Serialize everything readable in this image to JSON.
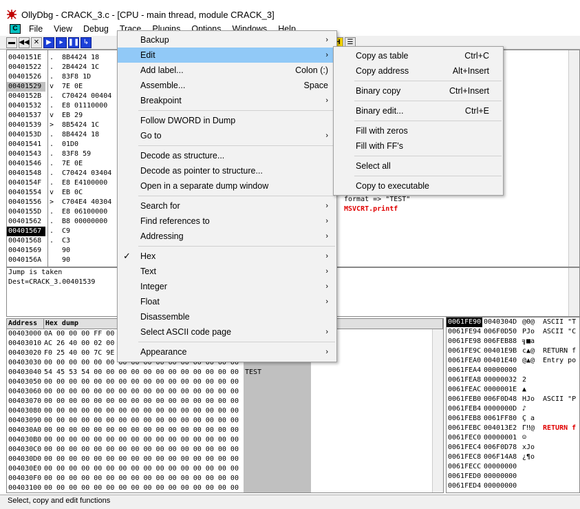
{
  "window": {
    "title": "OllyDbg - CRACK_3.c - [CPU - main thread, module CRACK_3]"
  },
  "menubar": {
    "items": [
      "File",
      "View",
      "Debug",
      "Trace",
      "Plugins",
      "Options",
      "Windows",
      "Help"
    ]
  },
  "toolbar": {
    "buttons": [
      "open",
      "restart",
      "close",
      "run",
      "step-into",
      "pause",
      "step-over",
      "M",
      "H",
      "list"
    ]
  },
  "cpu": {
    "addresses": [
      "0040151E",
      "00401522",
      "00401526",
      "00401529",
      "0040152B",
      "00401532",
      "00401537",
      "00401539",
      "0040153D",
      "00401541",
      "00401543",
      "00401546",
      "00401548",
      "0040154F",
      "00401554",
      "00401556",
      "0040155D",
      "00401562",
      "00401567",
      "00401568",
      "00401569",
      "0040156A"
    ],
    "marks": [
      ".",
      ".",
      ".",
      "v",
      ".",
      ".",
      "v",
      ">",
      ".",
      ".",
      ".",
      ".",
      ".",
      ".",
      "v",
      ">",
      ".",
      ".",
      ".",
      ".",
      "",
      ""
    ],
    "hex": [
      "8B4424 18",
      "2B4424 1C",
      "83F8 1D",
      "7E 0E",
      "C70424 00404",
      "E8 01110000",
      "EB 29",
      "8B5424 1C",
      "8B4424 18",
      "01D0",
      "83F8 59",
      "7E 0E",
      "C70424 03404",
      "E8 E4100000",
      "EB 0C",
      "C704E4 40304",
      "E8 06100000",
      "B8 00000000",
      "C9",
      "C3",
      "90",
      "90"
    ],
    "selected_address": "00401529",
    "eip_address": "00401567",
    "comments": [
      {
        "text": "format => \"TEST\"",
        "red": false
      },
      {
        "text": "MSVCRT.printf",
        "red": true
      }
    ]
  },
  "info": {
    "lines": [
      "Jump is taken",
      "Dest=CRACK_3.00401539"
    ]
  },
  "dump": {
    "headers": [
      "Address",
      "Hex dump"
    ],
    "rows": [
      {
        "addr": "00403000",
        "hex": "0A 00 00 00 FF 00",
        "ascii": ""
      },
      {
        "addr": "00403010",
        "hex": "AC 26 40 00 02 00",
        "ascii": ""
      },
      {
        "addr": "00403020",
        "hex": "F0 25 40 00 7C 9E",
        "ascii": ""
      },
      {
        "addr": "00403030",
        "hex": "00 00 00 00 00 00 00 00 00 00 00 00 00 00 00 00",
        "ascii": ""
      },
      {
        "addr": "00403040",
        "hex": "54 45 53 54 00 00 00 00 00 00 00 00 00 00 00 00",
        "ascii": "TEST"
      },
      {
        "addr": "00403050",
        "hex": "00 00 00 00 00 00 00 00 00 00 00 00 00 00 00 00",
        "ascii": ""
      },
      {
        "addr": "00403060",
        "hex": "00 00 00 00 00 00 00 00 00 00 00 00 00 00 00 00",
        "ascii": ""
      },
      {
        "addr": "00403070",
        "hex": "00 00 00 00 00 00 00 00 00 00 00 00 00 00 00 00",
        "ascii": ""
      },
      {
        "addr": "00403080",
        "hex": "00 00 00 00 00 00 00 00 00 00 00 00 00 00 00 00",
        "ascii": ""
      },
      {
        "addr": "00403090",
        "hex": "00 00 00 00 00 00 00 00 00 00 00 00 00 00 00 00",
        "ascii": ""
      },
      {
        "addr": "004030A0",
        "hex": "00 00 00 00 00 00 00 00 00 00 00 00 00 00 00 00",
        "ascii": ""
      },
      {
        "addr": "004030B0",
        "hex": "00 00 00 00 00 00 00 00 00 00 00 00 00 00 00 00",
        "ascii": ""
      },
      {
        "addr": "004030C0",
        "hex": "00 00 00 00 00 00 00 00 00 00 00 00 00 00 00 00",
        "ascii": ""
      },
      {
        "addr": "004030D0",
        "hex": "00 00 00 00 00 00 00 00 00 00 00 00 00 00 00 00",
        "ascii": ""
      },
      {
        "addr": "004030E0",
        "hex": "00 00 00 00 00 00 00 00 00 00 00 00 00 00 00 00",
        "ascii": ""
      },
      {
        "addr": "004030F0",
        "hex": "00 00 00 00 00 00 00 00 00 00 00 00 00 00 00 00",
        "ascii": ""
      },
      {
        "addr": "00403100",
        "hex": "00 00 00 00 00 00 00 00 00 00 00 00 00 00 00 00",
        "ascii": ""
      }
    ]
  },
  "stack": {
    "rows": [
      {
        "addr": "0061FE90",
        "val": "0040304D",
        "txt": "@0@",
        "cmt": "ASCII \"T",
        "red": false
      },
      {
        "addr": "0061FE94",
        "val": "006F0D50",
        "txt": "PJo",
        "cmt": "ASCII \"C",
        "red": false
      },
      {
        "addr": "0061FE98",
        "val": "006FEB88",
        "txt": "╗■a",
        "cmt": "",
        "red": false
      },
      {
        "addr": "0061FE9C",
        "val": "00401E9B",
        "txt": "c▲@",
        "cmt": "RETURN f",
        "red": false
      },
      {
        "addr": "0061FEA0",
        "val": "00401E40",
        "txt": "@▲@",
        "cmt": "Entry po",
        "red": false
      },
      {
        "addr": "0061FEA4",
        "val": "00000000",
        "txt": "",
        "cmt": "",
        "red": false
      },
      {
        "addr": "0061FEA8",
        "val": "00000032",
        "txt": "2",
        "cmt": "",
        "red": false
      },
      {
        "addr": "0061FEAC",
        "val": "0000001E",
        "txt": "▲",
        "cmt": "",
        "red": false
      },
      {
        "addr": "0061FEB0",
        "val": "006F0D48",
        "txt": "HJo",
        "cmt": "ASCII \"P",
        "red": false
      },
      {
        "addr": "0061FEB4",
        "val": "0000000D",
        "txt": "♪",
        "cmt": "",
        "red": false
      },
      {
        "addr": "0061FEB8",
        "val": "0061FF80",
        "txt": "Ç a",
        "cmt": "",
        "red": false
      },
      {
        "addr": "0061FEBC",
        "val": "004013E2",
        "txt": "Γ‼@",
        "cmt": "RETURN f",
        "red": true
      },
      {
        "addr": "0061FEC0",
        "val": "00000001",
        "txt": "☺",
        "cmt": "",
        "red": false
      },
      {
        "addr": "0061FEC4",
        "val": "006F0D78",
        "txt": "xJo",
        "cmt": "",
        "red": false
      },
      {
        "addr": "0061FEC8",
        "val": "006F14A8",
        "txt": "¿¶o",
        "cmt": "",
        "red": false
      },
      {
        "addr": "0061FECC",
        "val": "00000000",
        "txt": "",
        "cmt": "",
        "red": false
      },
      {
        "addr": "0061FED0",
        "val": "00000000",
        "txt": "",
        "cmt": "",
        "red": false
      },
      {
        "addr": "0061FED4",
        "val": "00000000",
        "txt": "",
        "cmt": "",
        "red": false
      }
    ]
  },
  "context_menu": {
    "items": [
      {
        "label": "Backup",
        "accel": "",
        "arrow": true,
        "checked": false,
        "highlight": false,
        "sep_after": false
      },
      {
        "label": "Edit",
        "accel": "",
        "arrow": true,
        "checked": false,
        "highlight": true,
        "sep_after": false
      },
      {
        "label": "Add label...",
        "accel": "Colon (:)",
        "arrow": false,
        "checked": false,
        "highlight": false,
        "sep_after": false
      },
      {
        "label": "Assemble...",
        "accel": "Space",
        "arrow": false,
        "checked": false,
        "highlight": false,
        "sep_after": false
      },
      {
        "label": "Breakpoint",
        "accel": "",
        "arrow": true,
        "checked": false,
        "highlight": false,
        "sep_after": true
      },
      {
        "label": "Follow DWORD in Dump",
        "accel": "",
        "arrow": false,
        "checked": false,
        "highlight": false,
        "sep_after": false
      },
      {
        "label": "Go to",
        "accel": "",
        "arrow": true,
        "checked": false,
        "highlight": false,
        "sep_after": true
      },
      {
        "label": "Decode as structure...",
        "accel": "",
        "arrow": false,
        "checked": false,
        "highlight": false,
        "sep_after": false
      },
      {
        "label": "Decode as pointer to structure...",
        "accel": "",
        "arrow": false,
        "checked": false,
        "highlight": false,
        "sep_after": false
      },
      {
        "label": "Open in a separate dump window",
        "accel": "",
        "arrow": false,
        "checked": false,
        "highlight": false,
        "sep_after": true
      },
      {
        "label": "Search for",
        "accel": "",
        "arrow": true,
        "checked": false,
        "highlight": false,
        "sep_after": false
      },
      {
        "label": "Find references to",
        "accel": "",
        "arrow": true,
        "checked": false,
        "highlight": false,
        "sep_after": false
      },
      {
        "label": "Addressing",
        "accel": "",
        "arrow": true,
        "checked": false,
        "highlight": false,
        "sep_after": true
      },
      {
        "label": "Hex",
        "accel": "",
        "arrow": true,
        "checked": true,
        "highlight": false,
        "sep_after": false
      },
      {
        "label": "Text",
        "accel": "",
        "arrow": true,
        "checked": false,
        "highlight": false,
        "sep_after": false
      },
      {
        "label": "Integer",
        "accel": "",
        "arrow": true,
        "checked": false,
        "highlight": false,
        "sep_after": false
      },
      {
        "label": "Float",
        "accel": "",
        "arrow": true,
        "checked": false,
        "highlight": false,
        "sep_after": false
      },
      {
        "label": "Disassemble",
        "accel": "",
        "arrow": false,
        "checked": false,
        "highlight": false,
        "sep_after": false
      },
      {
        "label": "Select ASCII code page",
        "accel": "",
        "arrow": true,
        "checked": false,
        "highlight": false,
        "sep_after": true
      },
      {
        "label": "Appearance",
        "accel": "",
        "arrow": true,
        "checked": false,
        "highlight": false,
        "sep_after": false
      }
    ]
  },
  "edit_submenu": {
    "items": [
      {
        "label": "Copy as table",
        "accel": "Ctrl+C",
        "sep_after": false
      },
      {
        "label": "Copy address",
        "accel": "Alt+Insert",
        "sep_after": true
      },
      {
        "label": "Binary copy",
        "accel": "Ctrl+Insert",
        "sep_after": true
      },
      {
        "label": "Binary edit...",
        "accel": "Ctrl+E",
        "sep_after": true
      },
      {
        "label": "Fill with zeros",
        "accel": "",
        "sep_after": false
      },
      {
        "label": "Fill with FF's",
        "accel": "",
        "sep_after": true
      },
      {
        "label": "Select all",
        "accel": "",
        "sep_after": true
      },
      {
        "label": "Copy to executable",
        "accel": "",
        "sep_after": false
      }
    ]
  },
  "status": {
    "text": "Select, copy and edit functions"
  }
}
